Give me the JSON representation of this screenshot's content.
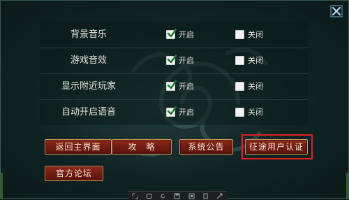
{
  "settings": [
    {
      "label": "背景音乐",
      "on_label": "开启",
      "off_label": "关闭",
      "on_checked": true,
      "off_checked": false
    },
    {
      "label": "游戏音效",
      "on_label": "开启",
      "off_label": "关闭",
      "on_checked": true,
      "off_checked": false
    },
    {
      "label": "显示附近玩家",
      "on_label": "开启",
      "off_label": "关闭",
      "on_checked": true,
      "off_checked": false
    },
    {
      "label": "自动开启语音",
      "on_label": "开启",
      "off_label": "关闭",
      "on_checked": true,
      "off_checked": false
    }
  ],
  "buttons": {
    "return_main": "返回主界面",
    "strategy": "攻　略",
    "announcement": "系统公告",
    "auth": "征途用户认证",
    "forum": "官方论坛"
  },
  "colors": {
    "accent_red": "#e02020",
    "button_gold_border": "#c99a5b",
    "close_icon": "#7fb5d6"
  },
  "icons": {
    "close": "close-icon",
    "checkbox_checked": "checkmark-icon"
  }
}
